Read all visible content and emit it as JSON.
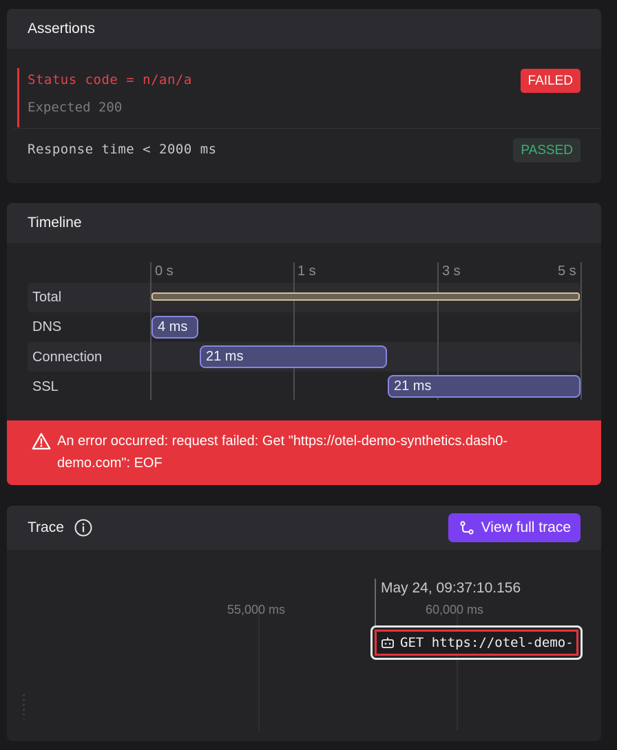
{
  "assertions": {
    "title": "Assertions",
    "items": [
      {
        "label": "Status code = n/an/a",
        "expected": "Expected 200",
        "status": "FAILED"
      },
      {
        "label": "Response time < 2000 ms",
        "status": "PASSED"
      }
    ]
  },
  "timeline": {
    "title": "Timeline",
    "ticks": [
      "0 s",
      "1 s",
      "3 s",
      "5 s"
    ],
    "rows": [
      {
        "label": "Total",
        "duration": ""
      },
      {
        "label": "DNS",
        "duration": "4 ms"
      },
      {
        "label": "Connection",
        "duration": "21 ms"
      },
      {
        "label": "SSL",
        "duration": "21 ms"
      }
    ],
    "error": "An error occurred: request failed: Get \"https://otel-demo-synthetics.dash0-demo.com\": EOF"
  },
  "trace": {
    "title": "Trace",
    "view_button": "View full trace",
    "ticks": [
      "55,000 ms",
      "60,000 ms"
    ],
    "cursor_time": "May 24, 09:37:10.156",
    "span_label": "GET https://otel-demo-"
  },
  "colors": {
    "background": "#1a1a1c",
    "failed": "#e5343b",
    "passed": "#3fae7a",
    "accent": "#7b3ff2",
    "timeline_bar": "#8686e0"
  },
  "icons": [
    "warning-icon",
    "info-icon",
    "trace-icon",
    "robot-icon"
  ]
}
